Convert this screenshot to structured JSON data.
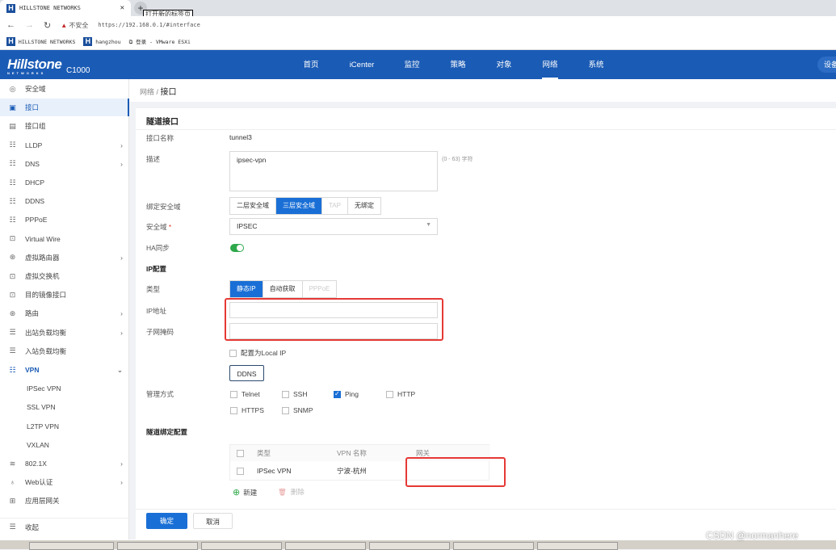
{
  "browser": {
    "tab_title": "HILLSTONE NETWORKS",
    "new_tab_tooltip": "打开新的标签页",
    "security_warning": "不安全",
    "url": "https://192.168.0.1/#interface",
    "bookmarks": [
      "HILLSTONE NETWORKS",
      "hangzhou",
      "登录 - VMware ESXi"
    ]
  },
  "header": {
    "brand": "Hillstone",
    "brand_sub": "NETWORKS",
    "model": "C1000",
    "nav": [
      "首页",
      "iCenter",
      "监控",
      "策略",
      "对象",
      "网络",
      "系统"
    ],
    "active_nav": "网络",
    "device_button": "设备"
  },
  "sidebar": {
    "items": [
      {
        "label": "安全域",
        "icon": "◎"
      },
      {
        "label": "接口",
        "icon": "▣",
        "active": true
      },
      {
        "label": "接口组",
        "icon": "▤"
      },
      {
        "label": "LLDP",
        "icon": "☷",
        "chev": "›"
      },
      {
        "label": "DNS",
        "icon": "☷",
        "chev": "›"
      },
      {
        "label": "DHCP",
        "icon": "☷"
      },
      {
        "label": "DDNS",
        "icon": "☷"
      },
      {
        "label": "PPPoE",
        "icon": "☷"
      },
      {
        "label": "Virtual Wire",
        "icon": "⊡"
      },
      {
        "label": "虚拟路由器",
        "icon": "⊛",
        "chev": "›"
      },
      {
        "label": "虚拟交换机",
        "icon": "⊡"
      },
      {
        "label": "目的镜像接口",
        "icon": "⊡"
      },
      {
        "label": "路由",
        "icon": "⊛",
        "chev": "›"
      },
      {
        "label": "出站负载均衡",
        "icon": "☰",
        "chev": "›"
      },
      {
        "label": "入站负载均衡",
        "icon": "☰"
      },
      {
        "label": "VPN",
        "icon": "☷",
        "chev": "⌄",
        "open": true
      },
      {
        "label": "IPSec VPN",
        "sub": true
      },
      {
        "label": "SSL VPN",
        "sub": true
      },
      {
        "label": "L2TP VPN",
        "sub": true
      },
      {
        "label": "VXLAN",
        "sub": true
      },
      {
        "label": "802.1X",
        "icon": "≋",
        "chev": "›"
      },
      {
        "label": "Web认证",
        "icon": "♁",
        "chev": "›"
      },
      {
        "label": "应用层网关",
        "icon": "⊞"
      }
    ],
    "collapse": "收起"
  },
  "breadcrumb": {
    "parent": "网络",
    "current": "接口"
  },
  "form": {
    "title": "隧道接口",
    "name_label": "接口名称",
    "name_value": "tunnel3",
    "desc_label": "描述",
    "desc_value": "ipsec-vpn",
    "desc_hint": "(0 - 63) 字符",
    "bind_label": "绑定安全域",
    "bind_options": [
      "二层安全域",
      "三层安全域",
      "TAP",
      "无绑定"
    ],
    "bind_selected": "三层安全域",
    "zone_label": "安全域",
    "zone_required": "*",
    "zone_value": "IPSEC",
    "ha_label": "HA同步",
    "ha_on": true,
    "ip_section": "IP配置",
    "type_label": "类型",
    "type_options": [
      "静态IP",
      "自动获取",
      "PPPoE"
    ],
    "type_selected": "静态IP",
    "ip_label": "IP地址",
    "ip_value": "",
    "mask_label": "子网掩码",
    "mask_value": "",
    "local_ip_label": "配置为Local IP",
    "local_ip_checked": false,
    "ddns_button": "DDNS",
    "mgmt_label": "管理方式",
    "mgmt": [
      {
        "label": "Telnet",
        "checked": false
      },
      {
        "label": "SSH",
        "checked": false
      },
      {
        "label": "Ping",
        "checked": true
      },
      {
        "label": "HTTP",
        "checked": false
      },
      {
        "label": "HTTPS",
        "checked": false
      },
      {
        "label": "SNMP",
        "checked": false
      }
    ],
    "tunnel_section": "隧道绑定配置",
    "table": {
      "headers": [
        "类型",
        "VPN 名称",
        "网关"
      ],
      "rows": [
        [
          "IPSec VPN",
          "宁波-杭州",
          ""
        ]
      ]
    },
    "add_label": "新建",
    "delete_label": "删除",
    "ok_button": "确定",
    "cancel_button": "取消"
  },
  "watermark": "CSDN @normanhere",
  "colors": {
    "header": "#1a5bb5",
    "primary": "#1a6fd6",
    "toggle": "#2ea84a",
    "highlight": "#e53935"
  }
}
